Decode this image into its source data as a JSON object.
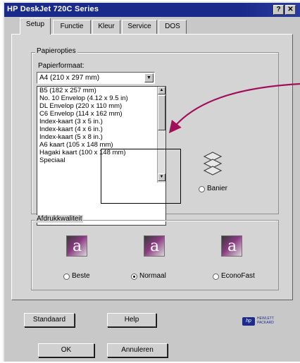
{
  "window": {
    "title": "HP DeskJet 720C Series",
    "help_btn": "?",
    "close_btn": "✕"
  },
  "tabs": [
    "Setup",
    "Functie",
    "Kleur",
    "Service",
    "DOS"
  ],
  "papieropties": {
    "group_label": "Papieropties",
    "format_label": "Papierformaat:",
    "selected": "A4 (210 x 297 mm)",
    "items": [
      "B5 (182 x 257 mm)",
      "No. 10 Envelop (4.12 x 9.5 in)",
      "DL Envelop (220 x 110 mm)",
      "C6 Envelop (114 x 162 mm)",
      "Index-kaart (3 x 5 in.)",
      "Index-kaart (4 x 6 in.)",
      "Index-kaart (5 x 8 in.)",
      "A6 kaart (105 x 148 mm)",
      "Hagaki kaart (100 x 148 mm)",
      "Speciaal"
    ],
    "banier_label": "Banier"
  },
  "afdrukkwaliteit": {
    "group_label": "Afdrukkwaliteit",
    "icon_letter": "a",
    "options": [
      {
        "label": "Beste",
        "selected": false
      },
      {
        "label": "Normaal",
        "selected": true
      },
      {
        "label": "EconoFast",
        "selected": false
      }
    ]
  },
  "buttons": {
    "standaard": "Standaard",
    "help": "Help",
    "ok": "OK",
    "annuleren": "Annuleren"
  },
  "logo": {
    "mark": "hp",
    "text": "HEWLETT\nPACKARD"
  },
  "colors": {
    "titlebar": "#1a2a8a",
    "arrow": "#a0105a",
    "dialog_bg": "#d4d4d4"
  }
}
